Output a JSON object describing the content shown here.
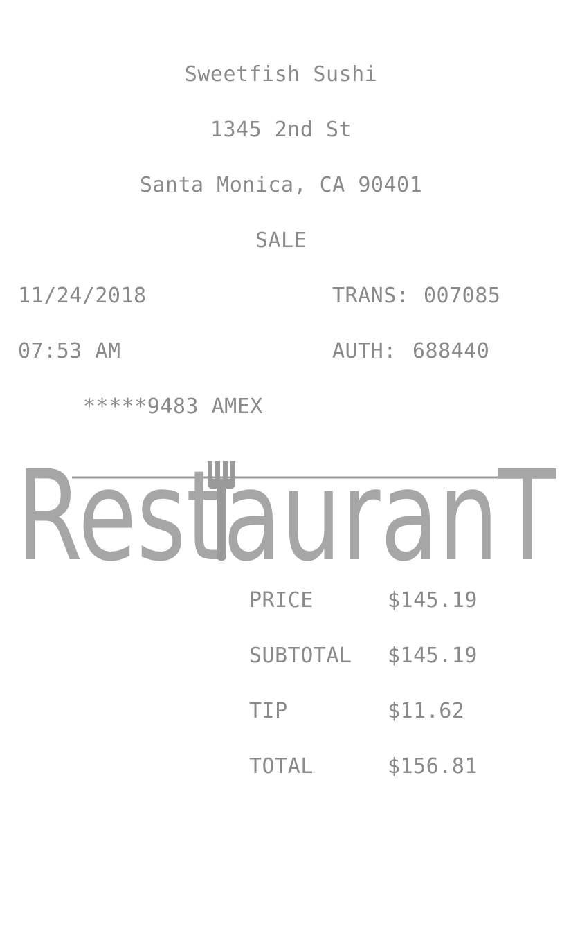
{
  "header": {
    "store_name": "Sweetfish Sushi",
    "address_line1": "1345 2nd St",
    "address_line2": "Santa Monica, CA 90401",
    "transaction_type": "SALE"
  },
  "transaction": {
    "date": "11/24/2018",
    "time": "07:53 AM",
    "trans_label": "TRANS:",
    "trans_number": "007085",
    "auth_label": "AUTH:",
    "auth_number": "688440",
    "card": "*****9483 AMEX"
  },
  "logo": {
    "text": "RestauranT",
    "icon": "fork-icon"
  },
  "totals": [
    {
      "label": "PRICE",
      "amount": "$145.19"
    },
    {
      "label": "SUBTOTAL",
      "amount": "$145.19"
    },
    {
      "label": "TIP",
      "amount": "$11.62"
    },
    {
      "label": "TOTAL",
      "amount": "$156.81"
    }
  ],
  "colors": {
    "text": "#8a8a8a",
    "logo": "#a6a6a6",
    "background": "#ffffff"
  }
}
